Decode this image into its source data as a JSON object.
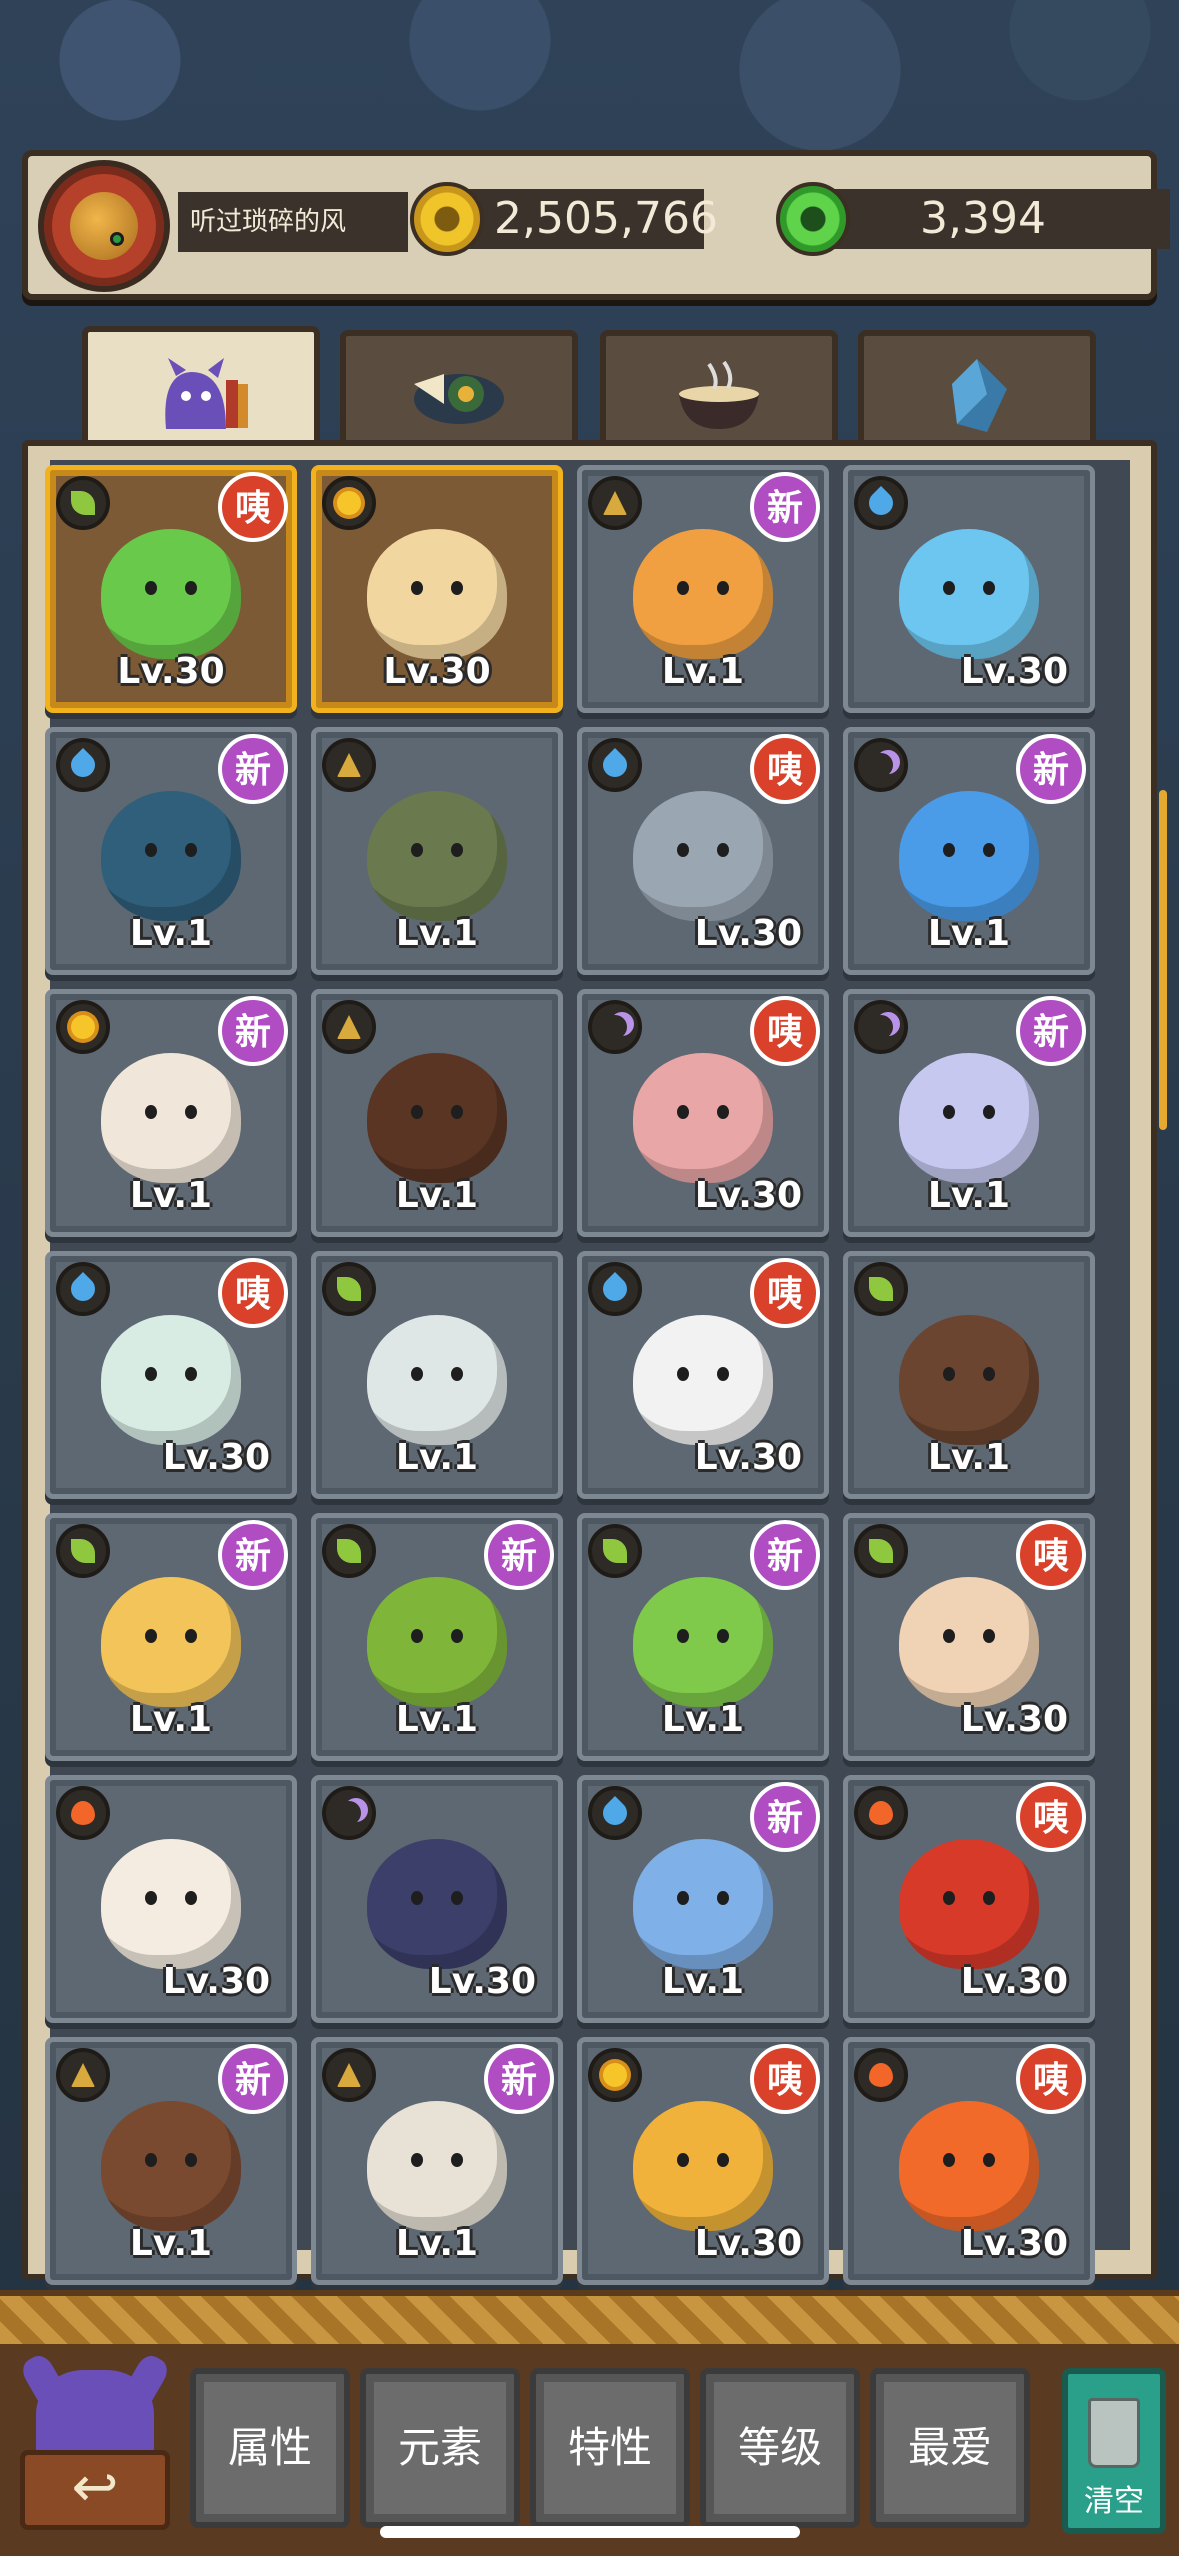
{
  "header": {
    "player_name": "听过琐碎的风",
    "coins": "2,505,766",
    "gems": "3,394"
  },
  "tabs": [
    {
      "name": "monsters",
      "icon": "monster-tab-icon",
      "active": true
    },
    {
      "name": "food",
      "icon": "food-plate-tab-icon",
      "active": false
    },
    {
      "name": "ramen",
      "icon": "ramen-bowl-tab-icon",
      "active": false
    },
    {
      "name": "crystals",
      "icon": "crystal-tab-icon",
      "active": false
    }
  ],
  "cards": [
    {
      "element": "leaf",
      "badge": "咦",
      "level": "Lv.30",
      "gold": true,
      "color": "#69c94a"
    },
    {
      "element": "sun",
      "badge": "",
      "level": "Lv.30",
      "gold": true,
      "color": "#f2d6a0"
    },
    {
      "element": "earth",
      "badge": "新",
      "level": "Lv.1",
      "gold": false,
      "color": "#f0a040"
    },
    {
      "element": "water",
      "badge": "",
      "level": "Lv.30",
      "gold": false,
      "color": "#6cc6f0"
    },
    {
      "element": "water",
      "badge": "新",
      "level": "Lv.1",
      "gold": false,
      "color": "#2f5f7a"
    },
    {
      "element": "earth",
      "badge": "",
      "level": "Lv.1",
      "gold": false,
      "color": "#6a7a4e"
    },
    {
      "element": "water",
      "badge": "咦",
      "level": "Lv.30",
      "gold": false,
      "color": "#9aa6b2"
    },
    {
      "element": "moon",
      "badge": "新",
      "level": "Lv.1",
      "gold": false,
      "color": "#4a9be8"
    },
    {
      "element": "sun",
      "badge": "新",
      "level": "Lv.1",
      "gold": false,
      "color": "#f1e6da"
    },
    {
      "element": "earth",
      "badge": "",
      "level": "Lv.1",
      "gold": false,
      "color": "#5a3524"
    },
    {
      "element": "moon",
      "badge": "咦",
      "level": "Lv.30",
      "gold": false,
      "color": "#e8a6a6"
    },
    {
      "element": "moon",
      "badge": "新",
      "level": "Lv.1",
      "gold": false,
      "color": "#c6c8f0"
    },
    {
      "element": "water",
      "badge": "咦",
      "level": "Lv.30",
      "gold": false,
      "color": "#d8ece4"
    },
    {
      "element": "leaf",
      "badge": "",
      "level": "Lv.1",
      "gold": false,
      "color": "#dfe6e6"
    },
    {
      "element": "water",
      "badge": "咦",
      "level": "Lv.30",
      "gold": false,
      "color": "#f2f2f2"
    },
    {
      "element": "leaf",
      "badge": "",
      "level": "Lv.1",
      "gold": false,
      "color": "#6b4530"
    },
    {
      "element": "leaf",
      "badge": "新",
      "level": "Lv.1",
      "gold": false,
      "color": "#f2c45a"
    },
    {
      "element": "leaf",
      "badge": "新",
      "level": "Lv.1",
      "gold": false,
      "color": "#7fb63a"
    },
    {
      "element": "leaf",
      "badge": "新",
      "level": "Lv.1",
      "gold": false,
      "color": "#7fca4a"
    },
    {
      "element": "leaf",
      "badge": "咦",
      "level": "Lv.30",
      "gold": false,
      "color": "#f0d2b4"
    },
    {
      "element": "fire",
      "badge": "",
      "level": "Lv.30",
      "gold": false,
      "color": "#f4ece0"
    },
    {
      "element": "moon",
      "badge": "",
      "level": "Lv.30",
      "gold": false,
      "color": "#3b3f6a"
    },
    {
      "element": "water",
      "badge": "新",
      "level": "Lv.1",
      "gold": false,
      "color": "#7fb0e8"
    },
    {
      "element": "fire",
      "badge": "咦",
      "level": "Lv.30",
      "gold": false,
      "color": "#d83a2a"
    },
    {
      "element": "earth",
      "badge": "新",
      "level": "Lv.1",
      "gold": false,
      "color": "#7a4a30"
    },
    {
      "element": "earth",
      "badge": "新",
      "level": "Lv.1",
      "gold": false,
      "color": "#e8e2d6"
    },
    {
      "element": "sun",
      "badge": "咦",
      "level": "Lv.30",
      "gold": false,
      "color": "#f0b23a"
    },
    {
      "element": "fire",
      "badge": "咦",
      "level": "Lv.30",
      "gold": false,
      "color": "#f26a2a"
    }
  ],
  "filters": [
    "属性",
    "元素",
    "特性",
    "等级",
    "最爱"
  ],
  "clear_label": "清空",
  "colors": {
    "new_badge": "#b04dc3",
    "hot_badge": "#d9412a",
    "gold_frame": "#f2b21e"
  }
}
